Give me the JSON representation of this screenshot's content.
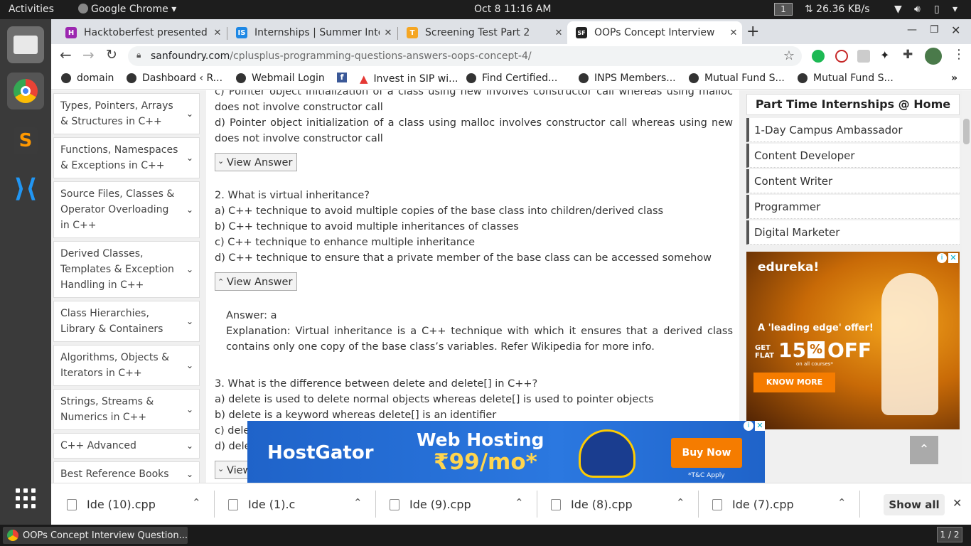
{
  "system": {
    "activities": "Activities",
    "app_name": "Google Chrome",
    "clock": "Oct 8  11:16 AM",
    "workspace": "1",
    "net_speed": "⇅ 26.36 KB/s",
    "taskbar_window": "OOPs Concept Interview Question...",
    "workspace_pager": "1 / 2"
  },
  "tabs": [
    {
      "title": "Hacktoberfest presented",
      "fav_color": "#9c27b0",
      "fav_text": "H"
    },
    {
      "title": "Internships | Summer Inte",
      "fav_color": "#1e88e5",
      "fav_text": "IS"
    },
    {
      "title": "Screening Test Part 2",
      "fav_color": "#f5a623",
      "fav_text": "T"
    },
    {
      "title": "OOPs Concept Interview",
      "fav_color": "#222222",
      "fav_text": "SF"
    }
  ],
  "address": {
    "domain": "sanfoundry.com",
    "path": "/cplusplus-programming-questions-answers-oops-concept-4/"
  },
  "bookmarks": [
    "domain",
    "Dashboard ‹ R...",
    "Webmail Login",
    "",
    "Invest in SIP wi...",
    "Find Certified...",
    "INPS Members...",
    "Mutual Fund S...",
    "Mutual Fund S..."
  ],
  "sidebar": {
    "items": [
      "Types, Pointers, Arrays & Structures in C++",
      "Functions, Namespaces & Exceptions in C++",
      "Source Files, Classes & Operator Overloading in C++",
      "Derived Classes, Templates & Exception Handling in C++",
      "Class Hierarchies, Library & Containers",
      "Algorithms, Objects & Iterators in C++",
      "Strings, Streams & Numerics in C++",
      "C++ Advanced",
      "Best Reference Books"
    ]
  },
  "main": {
    "q1_c_partial": "c) Pointer object initialization of a class using new involves constructor call whereas using malloc does not involve constructor call",
    "q1_d": "d) Pointer object initialization of a class using malloc involves constructor call whereas using new does not involve constructor call",
    "view_answer": "View Answer",
    "q2": "2. What is virtual inheritance?",
    "q2_a": "a) C++ technique to avoid multiple copies of the base class into children/derived class",
    "q2_b": "b) C++ technique to avoid multiple inheritances of classes",
    "q2_c": "c) C++ technique to enhance multiple inheritance",
    "q2_d": "d) C++ technique to ensure that a private member of the base class can be accessed somehow",
    "answer": "Answer: a",
    "explanation": "Explanation: Virtual inheritance is a C++ technique with which it ensures that a derived class contains only one copy of the base class’s variables. Refer Wikipedia for more info.",
    "q3": "3. What is the difference between delete and delete[] in C++?",
    "q3_a": "a) delete is used to delete normal objects whereas delete[] is used to pointer objects",
    "q3_b": "b) delete is a keyword whereas delete[] is an identifier",
    "q3_c": "c) dele",
    "q3_d": "d) dele",
    "view_partial": "View"
  },
  "rightbar": {
    "heading": "Part Time Internships @ Home",
    "items": [
      "1-Day Campus Ambassador",
      "Content Developer",
      "Content Writer",
      "Programmer",
      "Digital Marketer"
    ],
    "ad": {
      "brand": "edureka!",
      "tagline": "A 'leading edge' offer!",
      "get_flat": "GET FLAT",
      "percent": "15",
      "off": "OFF",
      "fine": "on all courses*",
      "cta": "KNOW MORE"
    }
  },
  "bottom_ad": {
    "brand": "HostGator",
    "headline": "Web Hosting",
    "price": "₹99/mo*",
    "cta": "Buy Now",
    "fine": "*T&C Apply"
  },
  "downloads": {
    "files": [
      "Ide (10).cpp",
      "Ide (1).c",
      "Ide (9).cpp",
      "Ide (8).cpp",
      "Ide (7).cpp"
    ],
    "show_all": "Show all"
  }
}
